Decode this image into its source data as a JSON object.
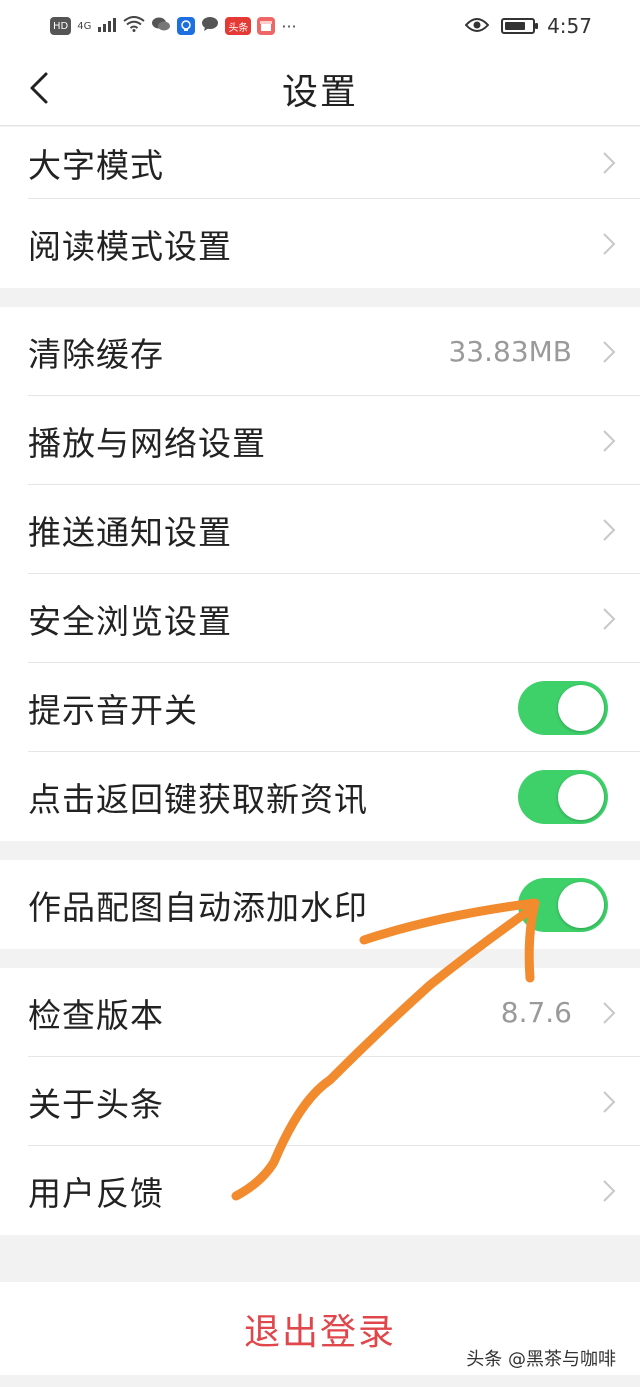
{
  "status_bar": {
    "left_items": [
      "HD",
      "4G",
      "头条"
    ],
    "time": "4:57",
    "battery_level": 0.75
  },
  "header": {
    "title": "设置"
  },
  "section1": [
    {
      "label": "大字模式"
    },
    {
      "label": "阅读模式设置"
    }
  ],
  "section2": [
    {
      "label": "清除缓存",
      "value": "33.83MB"
    },
    {
      "label": "播放与网络设置"
    },
    {
      "label": "推送通知设置"
    },
    {
      "label": "安全浏览设置"
    },
    {
      "label": "提示音开关",
      "toggle_on": true
    },
    {
      "label": "点击返回键获取新资讯",
      "toggle_on": true
    }
  ],
  "section3": [
    {
      "label": "作品配图自动添加水印",
      "toggle_on": true
    }
  ],
  "section4": [
    {
      "label": "检查版本",
      "value": "8.7.6"
    },
    {
      "label": "关于头条"
    },
    {
      "label": "用户反馈"
    }
  ],
  "logout": {
    "label": "退出登录"
  },
  "watermark": "头条 @黑茶与咖啡",
  "colors": {
    "toggle_on": "#3ed16a",
    "logout_text": "#e0464a",
    "annotation_arrow": "#f28a2e"
  }
}
